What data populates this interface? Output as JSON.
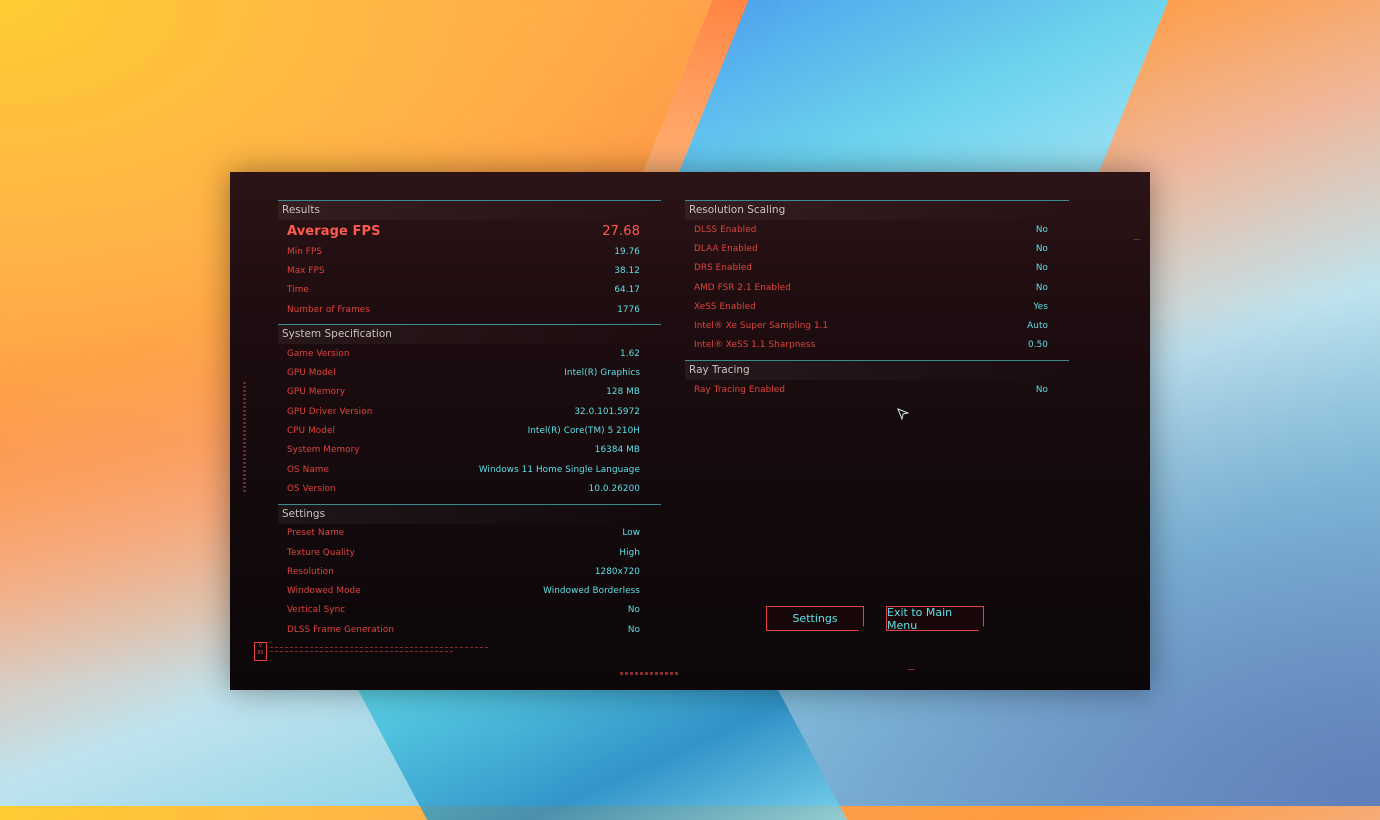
{
  "left": {
    "results": {
      "title": "Results",
      "average_label": "Average FPS",
      "average_value": "27.68",
      "rows": [
        {
          "label": "Min FPS",
          "value": "19.76"
        },
        {
          "label": "Max FPS",
          "value": "38.12"
        },
        {
          "label": "Time",
          "value": "64.17"
        },
        {
          "label": "Number of Frames",
          "value": "1776"
        }
      ]
    },
    "system": {
      "title": "System Specification",
      "rows": [
        {
          "label": "Game Version",
          "value": "1.62"
        },
        {
          "label": "GPU Model",
          "value": "Intel(R) Graphics"
        },
        {
          "label": "GPU Memory",
          "value": "128 MB"
        },
        {
          "label": "GPU Driver Version",
          "value": "32.0.101.5972"
        },
        {
          "label": "CPU Model",
          "value": "Intel(R) Core(TM) 5 210H"
        },
        {
          "label": "System Memory",
          "value": "16384 MB"
        },
        {
          "label": "OS Name",
          "value": "Windows 11 Home Single Language"
        },
        {
          "label": "OS Version",
          "value": "10.0.26200"
        }
      ]
    },
    "settings": {
      "title": "Settings",
      "rows": [
        {
          "label": "Preset Name",
          "value": "Low"
        },
        {
          "label": "Texture Quality",
          "value": "High"
        },
        {
          "label": "Resolution",
          "value": "1280x720"
        },
        {
          "label": "Windowed Mode",
          "value": "Windowed Borderless"
        },
        {
          "label": "Vertical Sync",
          "value": "No"
        },
        {
          "label": "DLSS Frame Generation",
          "value": "No"
        }
      ]
    }
  },
  "right": {
    "scaling": {
      "title": "Resolution Scaling",
      "rows": [
        {
          "label": "DLSS Enabled",
          "value": "No"
        },
        {
          "label": "DLAA Enabled",
          "value": "No"
        },
        {
          "label": "DRS Enabled",
          "value": "No"
        },
        {
          "label": "AMD FSR 2.1 Enabled",
          "value": "No"
        },
        {
          "label": "XeSS Enabled",
          "value": "Yes"
        },
        {
          "label": "Intel® Xe Super Sampling 1.1",
          "value": "Auto"
        },
        {
          "label": "Intel® XeSS 1.1 Sharpness",
          "value": "0.50"
        }
      ]
    },
    "raytracing": {
      "title": "Ray Tracing",
      "rows": [
        {
          "label": "Ray Tracing Enabled",
          "value": "No"
        }
      ]
    }
  },
  "buttons": {
    "settings": "Settings",
    "exit": "Exit to Main Menu"
  },
  "version_badge": "V 85",
  "colors": {
    "label_red": "#e0443e",
    "value_cyan": "#5ee0e8",
    "divider_teal": "#3a8a94"
  }
}
